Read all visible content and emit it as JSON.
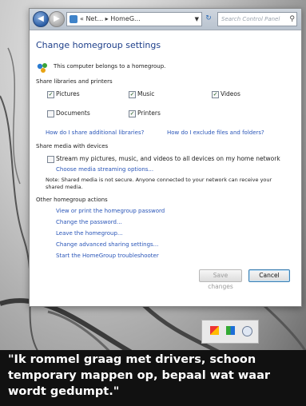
{
  "window": {
    "address_path": "« Net... ▸ HomeG...",
    "search_placeholder": "Search Control Panel",
    "title": "Change homegroup settings",
    "belongs_text": "This computer belongs to a homegroup."
  },
  "libraries": {
    "heading": "Share libraries and printers",
    "items": [
      {
        "label": "Pictures",
        "checked": true
      },
      {
        "label": "Music",
        "checked": true
      },
      {
        "label": "Videos",
        "checked": true
      },
      {
        "label": "Documents",
        "checked": false
      },
      {
        "label": "Printers",
        "checked": true
      }
    ],
    "link_additional": "How do I share additional libraries?",
    "link_exclude": "How do I exclude files and folders?"
  },
  "media": {
    "heading": "Share media with devices",
    "stream_label": "Stream my pictures, music, and videos to all devices on my home network",
    "stream_checked": false,
    "options_link": "Choose media streaming options...",
    "note": "Note: Shared media is not secure. Anyone connected to your network can receive your shared media."
  },
  "actions": {
    "heading": "Other homegroup actions",
    "links": [
      "View or print the homegroup password",
      "Change the password...",
      "Leave the homegroup...",
      "Change advanced sharing settings...",
      "Start the HomeGroup troubleshooter"
    ]
  },
  "buttons": {
    "save": "Save changes",
    "cancel": "Cancel"
  },
  "caption": {
    "line1": "\"Ik rommel graag met drivers, schoon",
    "line2": "temporary mappen op, bepaal wat waar",
    "line3": "wordt gedumpt.\""
  },
  "icons": [
    "back-icon",
    "forward-icon",
    "control-panel-icon",
    "refresh-icon",
    "search-icon",
    "homegroup-icon",
    "flag-icon",
    "network-icon",
    "clock-icon"
  ]
}
